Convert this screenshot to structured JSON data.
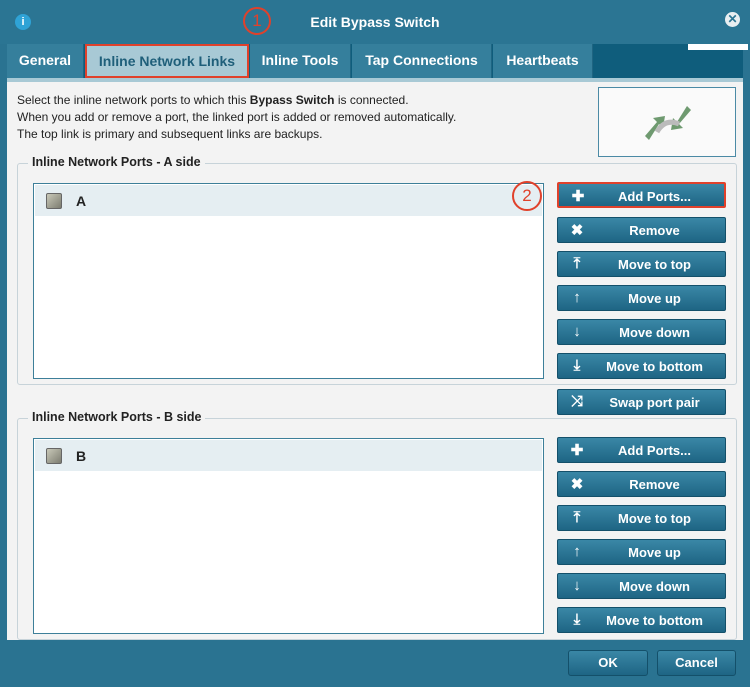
{
  "window": {
    "title": "Edit Bypass Switch",
    "annotation1": "1",
    "annotation2": "2"
  },
  "tabs": [
    "General",
    "Inline Network Links",
    "Inline Tools",
    "Tap Connections",
    "Heartbeats"
  ],
  "description": {
    "line1a": "Select the inline network ports to which this ",
    "line1b": "Bypass Switch",
    "line1c": " is connected.",
    "line2": "When you add or remove a port, the linked port is added or removed automatically.",
    "line3": "The top link is primary and subsequent links are backups."
  },
  "sideA": {
    "legend": "Inline Network Ports - A side",
    "ports": [
      "A"
    ]
  },
  "sideB": {
    "legend": "Inline Network Ports - B side",
    "ports": [
      "B"
    ]
  },
  "buttons": {
    "add": "Add Ports...",
    "remove": "Remove",
    "top": "Move to top",
    "up": "Move up",
    "down": "Move down",
    "bottom": "Move to bottom",
    "swap": "Swap port pair"
  },
  "footer": {
    "ok": "OK",
    "cancel": "Cancel"
  }
}
